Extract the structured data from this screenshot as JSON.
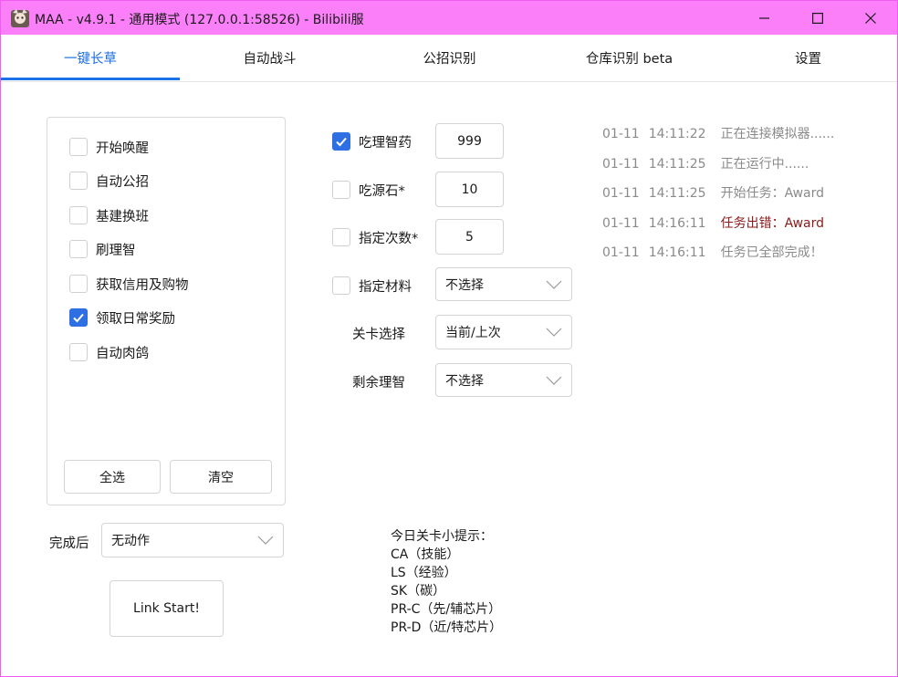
{
  "window": {
    "title": "MAA - v4.9.1 - 通用模式 (127.0.0.1:58526) - Bilibili服",
    "icon": "maa-app-icon",
    "colors": {
      "titlebar": "#fa7ff8",
      "accent": "#1a73e8"
    }
  },
  "tabs": [
    {
      "label": "一键长草",
      "active": true
    },
    {
      "label": "自动战斗",
      "active": false
    },
    {
      "label": "公招识别",
      "active": false
    },
    {
      "label": "仓库识别 beta",
      "active": false
    },
    {
      "label": "设置",
      "active": false
    }
  ],
  "tasks": [
    {
      "label": "开始唤醒",
      "checked": false
    },
    {
      "label": "自动公招",
      "checked": false
    },
    {
      "label": "基建换班",
      "checked": false
    },
    {
      "label": "刷理智",
      "checked": false
    },
    {
      "label": "获取信用及购物",
      "checked": false
    },
    {
      "label": "领取日常奖励",
      "checked": true
    },
    {
      "label": "自动肉鸽",
      "checked": false
    }
  ],
  "task_buttons": {
    "select_all": "全选",
    "clear": "清空"
  },
  "after_complete": {
    "label": "完成后",
    "value": "无动作"
  },
  "link_start": "Link Start!",
  "fight_options": {
    "medicine": {
      "label": "吃理智药",
      "checked": true,
      "value": "999"
    },
    "stone": {
      "label": "吃源石*",
      "checked": false,
      "value": "10"
    },
    "times": {
      "label": "指定次数*",
      "checked": false,
      "value": "5"
    },
    "material": {
      "label": "指定材料",
      "checked": false,
      "value": "不选择"
    },
    "stage": {
      "label": "关卡选择",
      "value": "当前/上次"
    },
    "remaining": {
      "label": "剩余理智",
      "value": "不选择"
    }
  },
  "tips": {
    "heading": "今日关卡小提示：",
    "lines": [
      "CA（技能）",
      "LS（经验）",
      "SK（碳）",
      "PR-C（先/辅芯片）",
      "PR-D（近/特芯片）"
    ]
  },
  "log": [
    {
      "date": "01-11",
      "time": "14:11:22",
      "message": "正在连接模拟器......",
      "error": false
    },
    {
      "date": "01-11",
      "time": "14:11:25",
      "message": "正在运行中......",
      "error": false
    },
    {
      "date": "01-11",
      "time": "14:11:25",
      "message": "开始任务：Award",
      "error": false
    },
    {
      "date": "01-11",
      "time": "14:16:11",
      "message": "任务出错：Award",
      "error": true
    },
    {
      "date": "01-11",
      "time": "14:16:11",
      "message": "任务已全部完成！",
      "error": false
    }
  ]
}
